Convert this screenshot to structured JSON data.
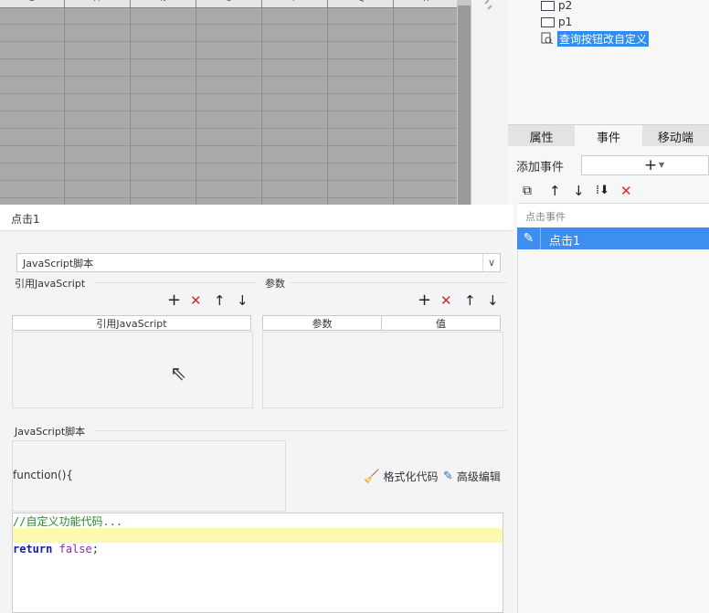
{
  "tree": {
    "items": [
      {
        "label": "p2"
      },
      {
        "label": "p1"
      },
      {
        "label": "查询按钮改自定义"
      }
    ]
  },
  "right_tabs": [
    "属性",
    "事件",
    "移动端"
  ],
  "events": {
    "add_label": "添加事件",
    "add_symbol": "+",
    "list_header": "点击事件",
    "selected": "点击1"
  },
  "editor": {
    "title": "点击1",
    "script_type": "JavaScript脚本",
    "ref_group": "引用JavaScript",
    "ref_column": "引用JavaScript",
    "param_group": "参数",
    "param_col": "参数",
    "value_col": "值",
    "script_group": "JavaScript脚本",
    "function_head": "function(){",
    "format_btn": "格式化代码",
    "advanced_btn": "高级编辑",
    "code_line1": "//自定义功能代码...",
    "code_kw": "return",
    "code_val": "false",
    "code_end": ";"
  },
  "sheet": {
    "columns": [
      "L",
      "M",
      "N",
      "O",
      "P",
      "Q",
      "R"
    ]
  }
}
